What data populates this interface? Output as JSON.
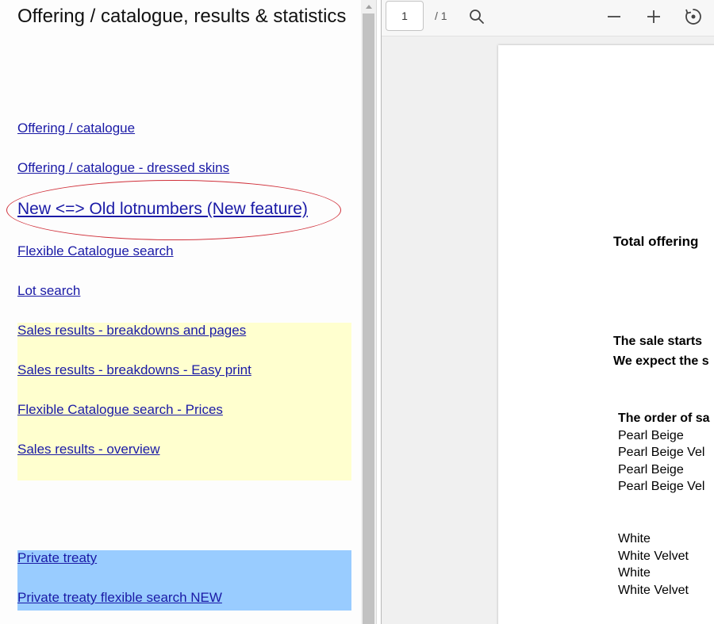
{
  "left_panel": {
    "title": "Offering / catalogue, results & statistics",
    "links": {
      "offering_catalogue": "Offering / catalogue",
      "offering_dressed": "Offering / catalogue - dressed skins",
      "new_old_lotnumbers": "New <=> Old lotnumbers (New feature)",
      "flexible_search": "Flexible Catalogue search",
      "lot_search": "Lot search"
    },
    "sales_links": {
      "breakdowns_pages": "Sales results - breakdowns and pages",
      "breakdowns_easy_print": "Sales results - breakdowns - Easy print",
      "flexible_search_prices": "Flexible Catalogue search - Prices",
      "overview": "Sales results - overview"
    },
    "private_links": {
      "private_treaty": "Private treaty",
      "private_flexible": "Private treaty flexible search NEW"
    }
  },
  "pdf_viewer": {
    "toolbar": {
      "page_value": "1",
      "page_total": "/ 1",
      "icons": [
        "search-icon",
        "zoom-out-icon",
        "zoom-in-icon",
        "rotate-icon"
      ]
    },
    "document": {
      "total_offering": "Total offering",
      "sale_starts": "The sale starts",
      "we_expect": "We expect the s",
      "order_of_sale": "The order of sa",
      "list_group_1": [
        "Pearl Beige",
        "Pearl Beige Vel",
        "Pearl Beige",
        "Pearl Beige Vel"
      ],
      "list_group_2": [
        "White",
        "White Velvet",
        "White",
        "White Velvet"
      ]
    }
  },
  "colors": {
    "link": "#1a1aa6",
    "sales_background": "#ffffcf",
    "private_background": "#99ccff",
    "highlight_ellipse": "#d0303a"
  }
}
